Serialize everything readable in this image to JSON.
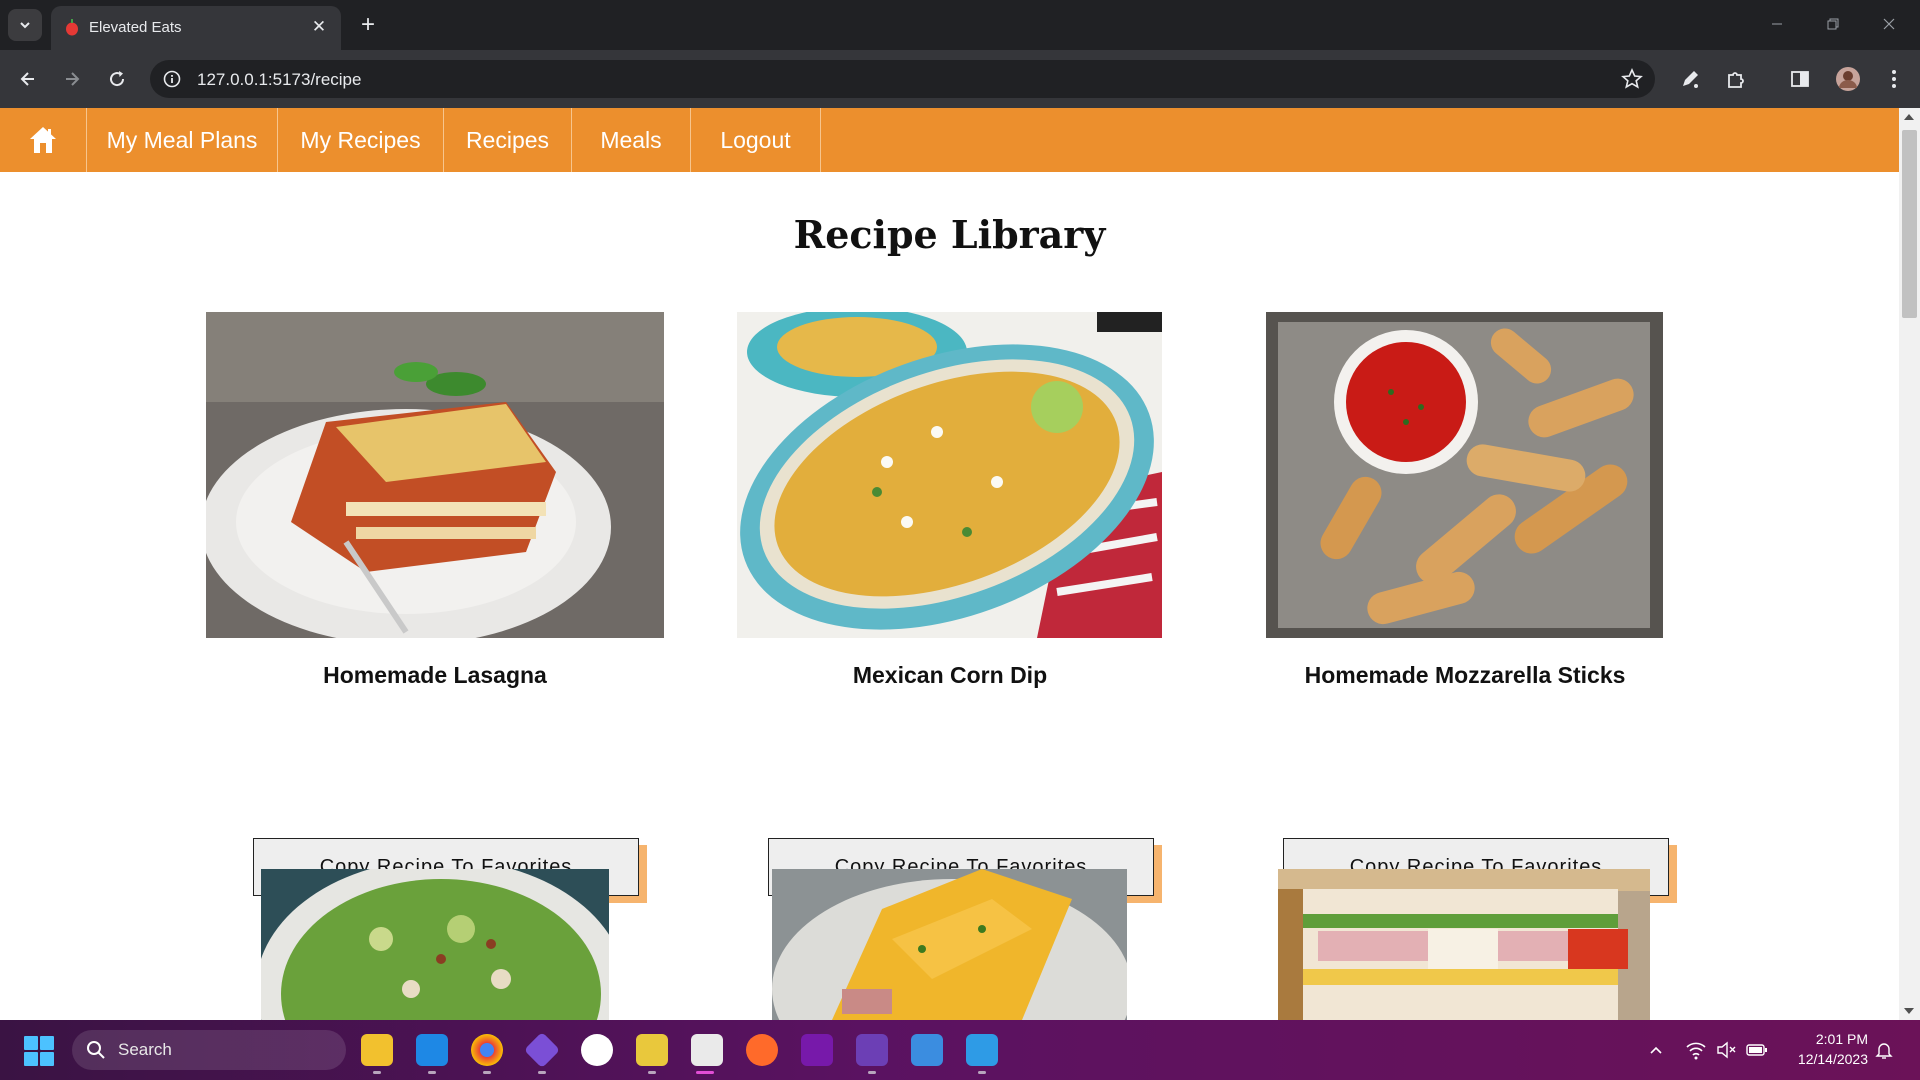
{
  "browser": {
    "tab_title": "Elevated Eats",
    "url": "127.0.0.1:5173/recipe"
  },
  "nav": {
    "items": [
      {
        "label": "My Meal Plans"
      },
      {
        "label": "My Recipes"
      },
      {
        "label": "Recipes"
      },
      {
        "label": "Meals"
      },
      {
        "label": "Logout"
      }
    ]
  },
  "page": {
    "heading": "Recipe Library"
  },
  "recipes": [
    {
      "title": "Homemade Lasagna",
      "button": "Copy Recipe To Favorites",
      "image": "lasagna"
    },
    {
      "title": "Mexican Corn Dip",
      "button": "Copy Recipe To Favorites",
      "image": "corn-dip"
    },
    {
      "title": "Homemade Mozzarella Sticks",
      "button": "Copy Recipe To Favorites",
      "image": "mozzarella-sticks"
    },
    {
      "title": "",
      "button": "",
      "image": "caesar-salad"
    },
    {
      "title": "",
      "button": "",
      "image": "omelette"
    },
    {
      "title": "",
      "button": "",
      "image": "club-sandwich"
    }
  ],
  "taskbar": {
    "search_placeholder": "Search",
    "time": "2:01 PM",
    "date": "12/14/2023"
  },
  "colors": {
    "nav_bg": "#ec8f2d",
    "button_shadow": "#f6b46e"
  }
}
